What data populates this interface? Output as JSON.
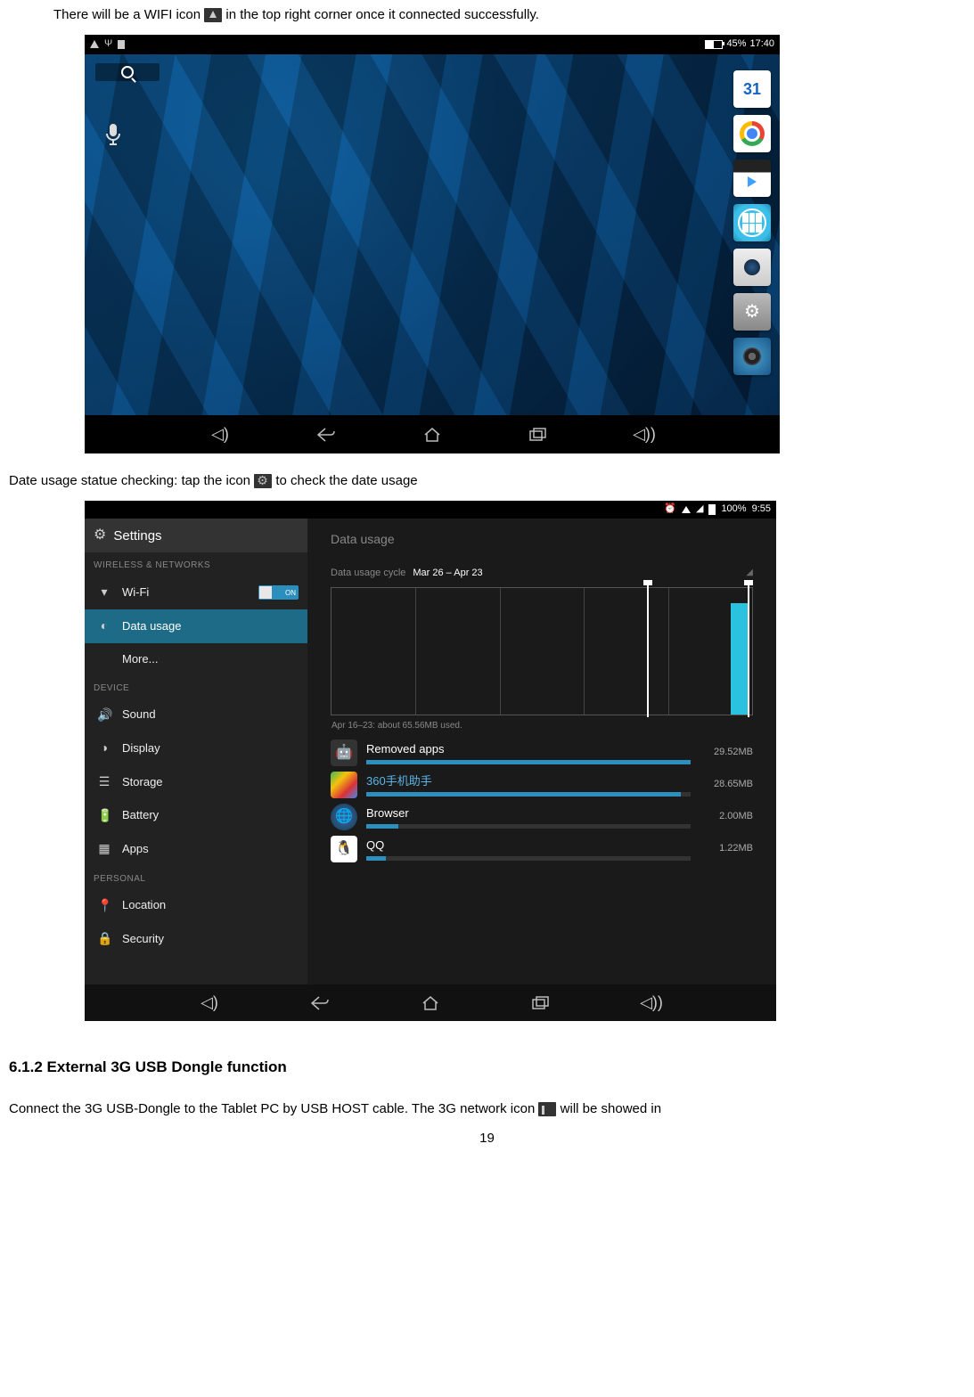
{
  "intro": {
    "line1a": "There will be a WIFI icon ",
    "line1b": " in the top right corner once it connected successfully."
  },
  "shot1": {
    "status": {
      "battery_pct": "45%",
      "time": "17:40"
    },
    "calendar_day": "31",
    "nav_icons": [
      "volume-down",
      "back",
      "home",
      "recent",
      "volume-up"
    ]
  },
  "mid_text": {
    "a": "Date usage statue checking: tap the icon ",
    "b": " to check the date usage"
  },
  "shot2": {
    "status": {
      "battery_pct": "100%",
      "time": "9:55"
    },
    "title": "Settings",
    "cat_wireless": "WIRELESS & NETWORKS",
    "cat_device": "DEVICE",
    "cat_personal": "PERSONAL",
    "sidebar": {
      "wifi": "Wi-Fi",
      "wifi_toggle": "ON",
      "data_usage": "Data usage",
      "more": "More...",
      "sound": "Sound",
      "display": "Display",
      "storage": "Storage",
      "battery": "Battery",
      "apps": "Apps",
      "location": "Location",
      "security": "Security"
    },
    "main": {
      "header": "Data usage",
      "cycle_label": "Data usage cycle",
      "cycle_value": "Mar 26 – Apr 23",
      "caption": "Apr 16–23: about 65.56MB used.",
      "apps": [
        {
          "name": "Removed apps",
          "size": "29.52MB",
          "pct": 100,
          "icon": "droid",
          "blue": false
        },
        {
          "name": "360手机助手",
          "size": "28.65MB",
          "pct": 97,
          "icon": "360",
          "blue": true
        },
        {
          "name": "Browser",
          "size": "2.00MB",
          "pct": 10,
          "icon": "browser",
          "blue": false
        },
        {
          "name": "QQ",
          "size": "1.22MB",
          "pct": 6,
          "icon": "qq",
          "blue": false
        }
      ]
    }
  },
  "chart_data": {
    "type": "bar",
    "title": "Data usage",
    "subtitle": "Apr 16–23: about 65.56MB used.",
    "xlabel": "Data usage cycle Mar 26 – Apr 23",
    "ylabel": "MB",
    "categories": [
      "Removed apps",
      "360手机助手",
      "Browser",
      "QQ"
    ],
    "values": [
      29.52,
      28.65,
      2.0,
      1.22
    ],
    "ylim": [
      0,
      30
    ]
  },
  "section_heading": "6.1.2 External 3G USB Dongle function",
  "footer": {
    "a": "Connect the 3G USB-Dongle to the Tablet PC by USB HOST cable. The 3G network icon ",
    "b": " will be showed in"
  },
  "page_number": "19"
}
